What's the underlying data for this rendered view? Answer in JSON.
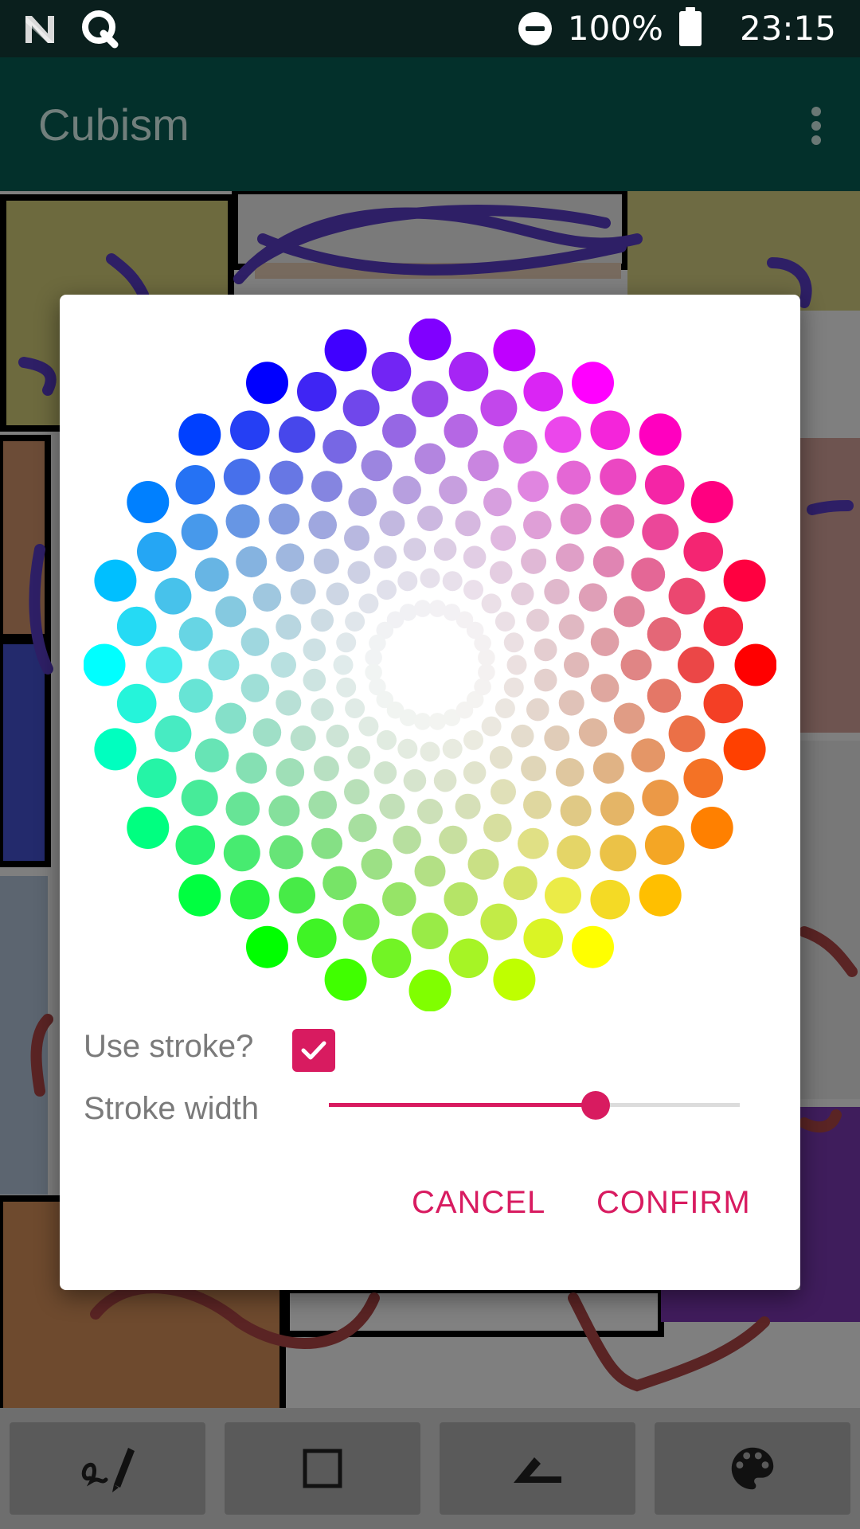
{
  "status_bar": {
    "battery_percent": "100%",
    "time": "23:15",
    "icons": [
      "n-logo-icon",
      "q-logo-icon",
      "do-not-disturb-icon",
      "battery-icon"
    ]
  },
  "app_bar": {
    "title": "Cubism",
    "overflow_icon": "more-vert-icon"
  },
  "dialog": {
    "color_wheel": {
      "rings": 10,
      "dots_per_ring": 24,
      "center_color": "#ffffff"
    },
    "use_stroke": {
      "label": "Use stroke?",
      "checked": true
    },
    "stroke_width": {
      "label": "Stroke width",
      "value_fraction": 0.65
    },
    "cancel_label": "CANCEL",
    "confirm_label": "CONFIRM",
    "accent_color": "#d81b60"
  },
  "toolbar": {
    "tools": [
      {
        "icon": "draw-signature-icon"
      },
      {
        "icon": "square-outline-icon"
      },
      {
        "icon": "angle-icon"
      },
      {
        "icon": "palette-icon"
      }
    ]
  }
}
